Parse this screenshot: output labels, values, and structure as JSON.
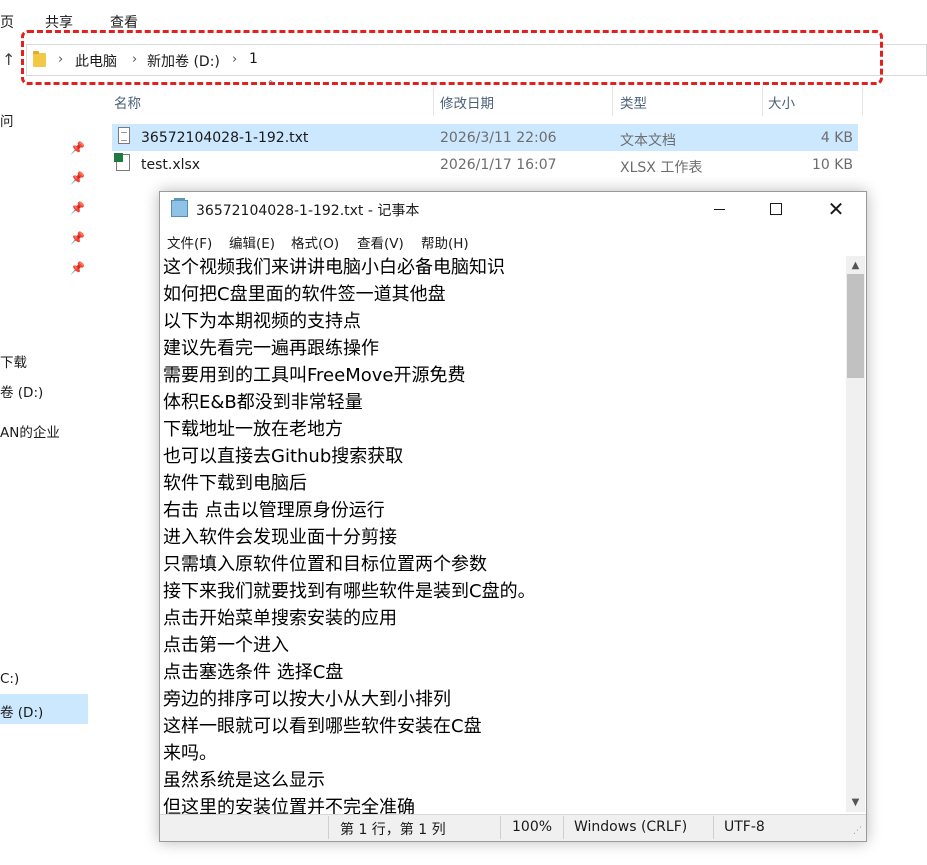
{
  "explorer": {
    "ribbon_tabs": [
      "页",
      "共享",
      "查看"
    ],
    "address": {
      "breadcrumbs": [
        "此电脑",
        "新加卷 (D:)",
        "1"
      ],
      "highlight_color": "#e3201d"
    },
    "nav_items": [
      "问",
      "下载",
      "卷 (D:)",
      "AN的企业",
      "C:)",
      "卷 (D:)"
    ],
    "columns": [
      "名称",
      "修改日期",
      "类型",
      "大小"
    ],
    "files": [
      {
        "name": "36572104028-1-192.txt",
        "modified": "2026/3/11 22:06",
        "type": "文本文档",
        "size": "4 KB",
        "selected": true,
        "icon": "text-file-icon"
      },
      {
        "name": "test.xlsx",
        "modified": "2026/1/17 16:07",
        "type": "XLSX 工作表",
        "size": "10 KB",
        "selected": false,
        "icon": "excel-file-icon"
      }
    ]
  },
  "notepad": {
    "title": "36572104028-1-192.txt - 记事本",
    "menu": [
      "文件(F)",
      "编辑(E)",
      "格式(O)",
      "查看(V)",
      "帮助(H)"
    ],
    "lines": [
      "这个视频我们来讲讲电脑小白必备电脑知识",
      "如何把C盘里面的软件签一道其他盘",
      "以下为本期视频的支持点",
      "建议先看完一遍再跟练操作",
      "需要用到的工具叫FreeMove开源免费",
      "体积E&B都没到非常轻量",
      "下载地址一放在老地方",
      "也可以直接去Github搜索获取",
      "软件下载到电脑后",
      "右击 点击以管理原身份运行",
      "进入软件会发现业面十分剪接",
      "只需填入原软件位置和目标位置两个参数",
      "接下来我们就要找到有哪些软件是装到C盘的。",
      "点击开始菜单搜索安装的应用",
      "点击第一个进入",
      "点击塞选条件 选择C盘",
      "旁边的排序可以按大小从大到小排列",
      "这样一眼就可以看到哪些软件安装在C盘",
      "来吗。",
      "虽然系统是这么显示",
      "但这里的安装位置并不完全准确"
    ],
    "status": {
      "position": "第 1 行，第 1 列",
      "zoom": "100%",
      "line_ending": "Windows (CRLF)",
      "encoding": "UTF-8"
    }
  }
}
